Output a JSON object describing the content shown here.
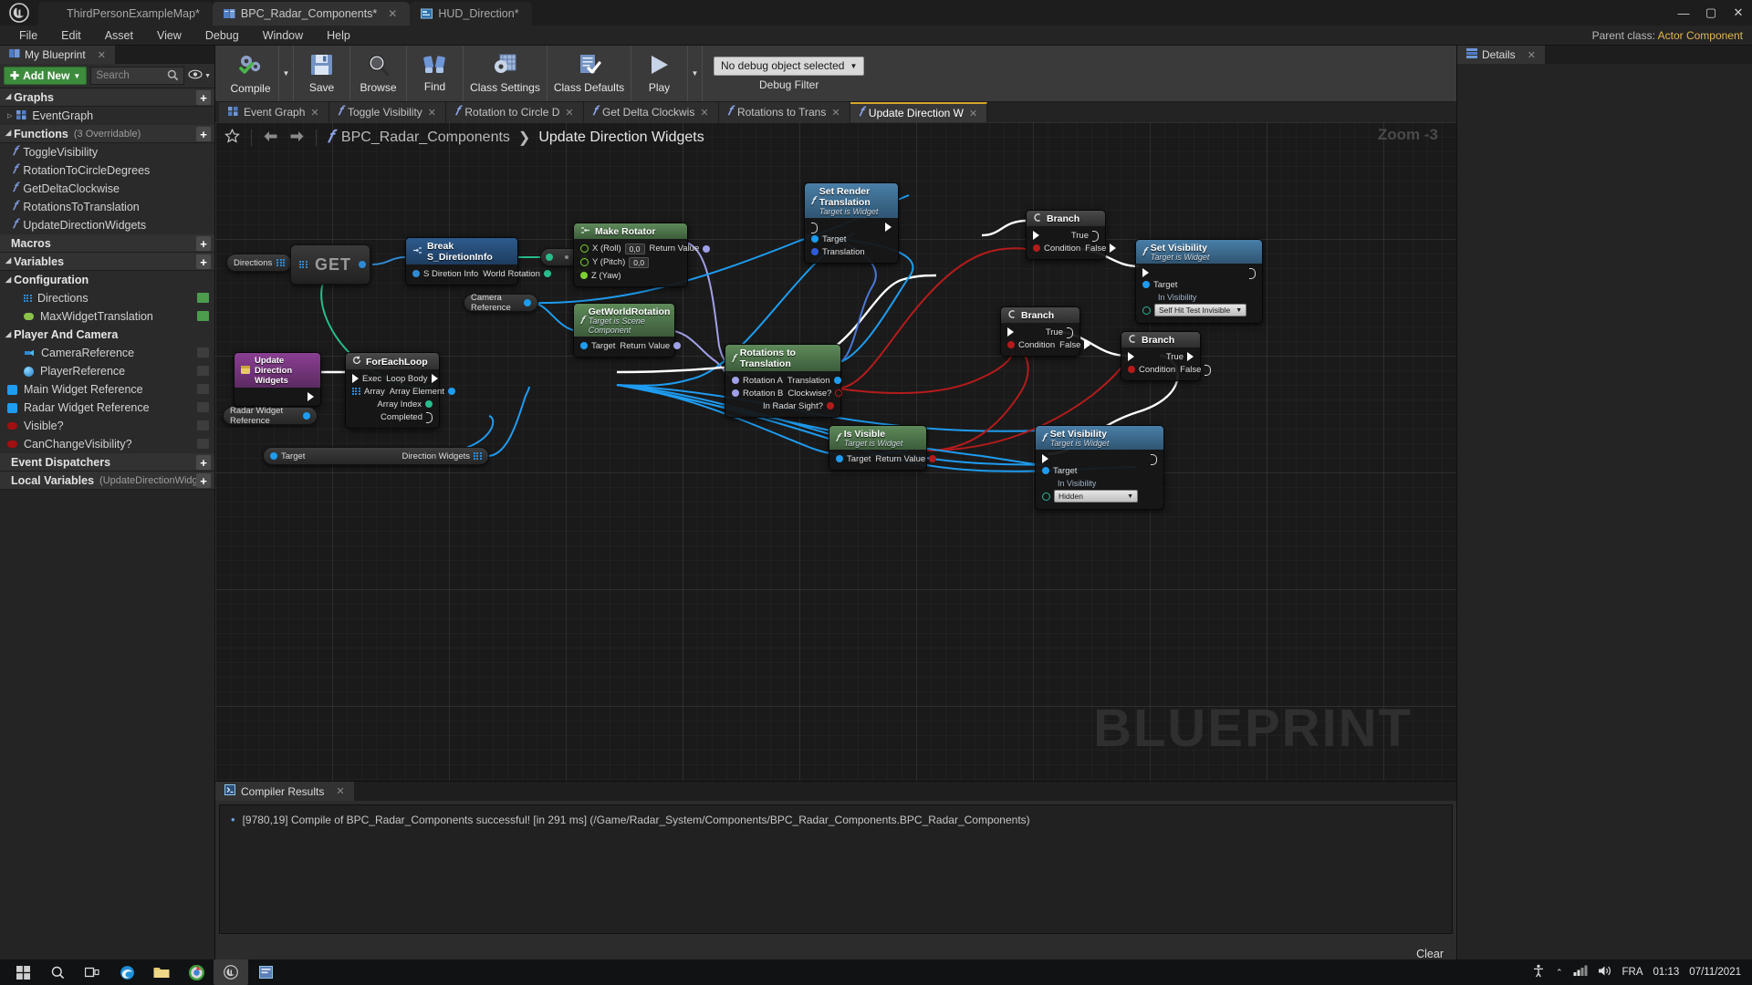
{
  "titlebar": {
    "logo": "ue-logo",
    "tabs": [
      {
        "label": "ThirdPersonExampleMap*",
        "icon": "map-icon",
        "active": false
      },
      {
        "label": "BPC_Radar_Components*",
        "icon": "blueprint-icon",
        "active": true
      },
      {
        "label": "HUD_Direction*",
        "icon": "widget-icon",
        "active": false
      }
    ],
    "window_controls": [
      "minimize",
      "maximize",
      "close"
    ]
  },
  "menubar": {
    "items": [
      "File",
      "Edit",
      "Asset",
      "View",
      "Debug",
      "Window",
      "Help"
    ],
    "parent_class_label": "Parent class:",
    "parent_class_value": "Actor Component"
  },
  "myblueprint": {
    "tab_label": "My Blueprint",
    "add_new_label": "Add New",
    "search_placeholder": "Search",
    "sections": {
      "graphs": {
        "label": "Graphs",
        "items": [
          {
            "label": "EventGraph",
            "icon": "eventgraph-icon"
          }
        ]
      },
      "functions": {
        "label": "Functions",
        "sub": "(3 Overridable)",
        "items": [
          {
            "label": "ToggleVisibility"
          },
          {
            "label": "RotationToCircleDegrees"
          },
          {
            "label": "GetDeltaClockwise"
          },
          {
            "label": "RotationsToTranslation"
          },
          {
            "label": "UpdateDirectionWidgets"
          }
        ]
      },
      "macros": {
        "label": "Macros"
      },
      "variables": {
        "label": "Variables",
        "categories": [
          {
            "label": "Configuration",
            "items": [
              {
                "label": "Directions",
                "color": "#2f8ad4",
                "kind": "array",
                "toggle": "green"
              },
              {
                "label": "MaxWidgetTranslation",
                "color": "#8bc34a",
                "kind": "float",
                "toggle": "green"
              }
            ]
          },
          {
            "label": "Player And Camera",
            "items": [
              {
                "label": "CameraReference",
                "color": "#2f8ad4",
                "kind": "object",
                "toggle": "plain"
              },
              {
                "label": "PlayerReference",
                "color": "#35a7e0",
                "kind": "object",
                "toggle": "plain"
              }
            ]
          }
        ],
        "loose_items": [
          {
            "label": "Main Widget Reference",
            "color": "#1e9cf0",
            "kind": "object",
            "toggle": "plain"
          },
          {
            "label": "Radar Widget Reference",
            "color": "#1e9cf0",
            "kind": "object",
            "toggle": "plain"
          },
          {
            "label": "Visible?",
            "color": "#a01010",
            "kind": "bool",
            "toggle": "plain"
          },
          {
            "label": "CanChangeVisibility?",
            "color": "#a01010",
            "kind": "bool",
            "toggle": "plain"
          }
        ]
      },
      "event_dispatchers": {
        "label": "Event Dispatchers"
      },
      "local_variables": {
        "label": "Local Variables",
        "sub": "(UpdateDirectionWidg"
      }
    }
  },
  "toolbar": {
    "buttons": [
      {
        "label": "Compile",
        "icon": "compile-icon",
        "dropdown": true
      },
      {
        "label": "Save",
        "icon": "save-icon"
      },
      {
        "label": "Browse",
        "icon": "browse-icon"
      },
      {
        "label": "Find",
        "icon": "find-icon"
      },
      {
        "label": "Class Settings",
        "icon": "class-settings-icon"
      },
      {
        "label": "Class Defaults",
        "icon": "class-defaults-icon"
      },
      {
        "label": "Play",
        "icon": "play-icon",
        "dropdown": true
      }
    ],
    "debug_selected": "No debug object selected",
    "debug_filter_label": "Debug Filter"
  },
  "graphtabs": [
    {
      "label": "Event Graph",
      "icon": "eventgraph-icon",
      "active": false
    },
    {
      "label": "Toggle Visibility",
      "icon": "function-icon",
      "active": false
    },
    {
      "label": "Rotation to Circle D",
      "icon": "function-icon",
      "active": false
    },
    {
      "label": "Get Delta Clockwis",
      "icon": "function-icon",
      "active": false
    },
    {
      "label": "Rotations to Trans",
      "icon": "function-icon",
      "active": false
    },
    {
      "label": "Update Direction W",
      "icon": "function-icon",
      "active": true
    }
  ],
  "breadcrumb": {
    "root": "BPC_Radar_Components",
    "separator": "❯",
    "current": "Update Direction Widgets",
    "zoom": "Zoom -3",
    "star_icon": "favorite-star-icon",
    "back_icon": "back-arrow-icon",
    "forward_icon": "forward-arrow-icon"
  },
  "graph": {
    "watermark": "BLUEPRINT",
    "nodes": {
      "directions_var": {
        "title": "Directions"
      },
      "get_node": {
        "title": "GET"
      },
      "break_s_direction": {
        "title": "Break S_DiretionInfo",
        "in_pin": "S Diretion Info",
        "out_pin": "World Rotation"
      },
      "make_rotator": {
        "title": "Make Rotator",
        "pins": [
          {
            "label": "X (Roll)",
            "value": "0,0"
          },
          {
            "label": "Y (Pitch)",
            "value": "0,0"
          },
          {
            "label": "Z (Yaw)",
            "value": ""
          }
        ],
        "out_pin": "Return Value"
      },
      "camera_reference_var": {
        "title": "Camera Reference"
      },
      "get_world_rotation": {
        "title": "GetWorldRotation",
        "subtitle": "Target is Scene Component",
        "in_pin": "Target",
        "out_pin": "Return Value"
      },
      "update_direction_widgets_event": {
        "title": "Update Direction Widgets"
      },
      "foreach_loop": {
        "title": "ForEachLoop",
        "in_exec": "Exec",
        "in_array": "Array",
        "out_loop_body": "Loop Body",
        "out_array_element": "Array Element",
        "out_array_index": "Array Index",
        "out_completed": "Completed"
      },
      "radar_widget_reference_var": {
        "title": "Radar Widget Reference"
      },
      "direction_widgets_get": {
        "in_pin": "Target",
        "out_pin": "Direction Widgets"
      },
      "rotations_to_translation": {
        "title": "Rotations to Translation",
        "in_a": "Rotation A",
        "in_b": "Rotation B",
        "out_translation": "Translation",
        "out_clockwise": "Clockwise?",
        "out_radar_sight": "In Radar Sight?"
      },
      "set_render_translation": {
        "title": "Set Render Translation",
        "subtitle": "Target is Widget",
        "in_target": "Target",
        "in_translation": "Translation"
      },
      "branch_1": {
        "title": "Branch",
        "condition": "Condition",
        "true": "True",
        "false": "False"
      },
      "branch_2": {
        "title": "Branch",
        "condition": "Condition",
        "true": "True",
        "false": "False"
      },
      "branch_3": {
        "title": "Branch",
        "condition": "Condition",
        "true": "True",
        "false": "False"
      },
      "set_visibility_1": {
        "title": "Set Visibility",
        "subtitle": "Target is Widget",
        "in_target": "Target",
        "in_visibility_label": "In Visibility",
        "in_visibility_value": "Self Hit Test Invisible"
      },
      "set_visibility_2": {
        "title": "Set Visibility",
        "subtitle": "Target is Widget",
        "in_target": "Target",
        "in_visibility_label": "In Visibility",
        "in_visibility_value": "Hidden"
      },
      "is_visible": {
        "title": "Is Visible",
        "subtitle": "Target is Widget",
        "in_target": "Target",
        "out_pin": "Return Value"
      }
    }
  },
  "compiler_results": {
    "tab_label": "Compiler Results",
    "messages": [
      "[9780,19] Compile of BPC_Radar_Components successful! [in 291 ms] (/Game/Radar_System/Components/BPC_Radar_Components.BPC_Radar_Components)"
    ],
    "clear_label": "Clear"
  },
  "details": {
    "tab_label": "Details"
  },
  "taskbar": {
    "icons": [
      "start-icon",
      "search-icon",
      "taskview-icon",
      "edge-icon",
      "explorer-icon",
      "chrome-icon",
      "unreal-icon",
      "app-icon"
    ],
    "tray": {
      "accessibility_icon": "accessibility-icon",
      "chevron_icon": "chevron-up-icon",
      "network_icon": "network-icon",
      "volume_icon": "volume-icon",
      "language": "FRA",
      "time": "01:13",
      "date": "07/11/2021"
    }
  },
  "colors": {
    "exec_white": "#ffffff",
    "object_blue": "#1e9cf0",
    "bool_red": "#a01010",
    "struct_blue": "#3a6fd8",
    "rotator_purple": "#a0a0e8",
    "array_green": "#2bbf8e",
    "float_green": "#8bc34a",
    "accent_yellow": "#d9a62a"
  }
}
